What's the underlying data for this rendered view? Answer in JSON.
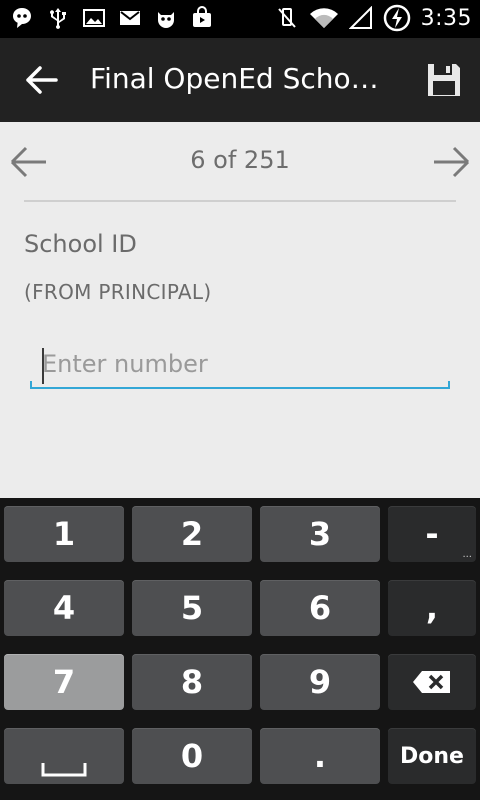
{
  "status_bar": {
    "time": "3:35",
    "icons_left": [
      "talk-icon",
      "usb-icon",
      "image-icon",
      "gmail-icon",
      "android-icon",
      "bag-icon"
    ],
    "icons_right": [
      "mute-icon",
      "wifi-icon",
      "signal-icon",
      "battery-charging-icon"
    ]
  },
  "action_bar": {
    "title": "Final OpenEd School…",
    "back_icon": "arrow-back-icon",
    "save_icon": "save-icon"
  },
  "nav": {
    "position": "6 of 251",
    "prev_icon": "arrow-left-icon",
    "next_icon": "arrow-right-icon"
  },
  "question": {
    "label": "School ID",
    "hint": "(FROM PRINCIPAL)",
    "placeholder": "Enter number",
    "value": ""
  },
  "keyboard": {
    "rows": [
      [
        "1",
        "2",
        "3",
        "-"
      ],
      [
        "4",
        "5",
        "6",
        ","
      ],
      [
        "7",
        "8",
        "9",
        "backspace"
      ],
      [
        "space",
        "0",
        ".",
        "Done"
      ]
    ],
    "k1": "1",
    "k2": "2",
    "k3": "3",
    "kdash": "-",
    "k4": "4",
    "k5": "5",
    "k6": "6",
    "kcomma": ",",
    "k7": "7",
    "k8": "8",
    "k9": "9",
    "k0": "0",
    "kdot": ".",
    "done": "Done",
    "dots": "..."
  },
  "colors": {
    "accent": "#33a7d6",
    "action_bar": "#222222",
    "background": "#ececec",
    "keyboard_bg": "#151515"
  }
}
